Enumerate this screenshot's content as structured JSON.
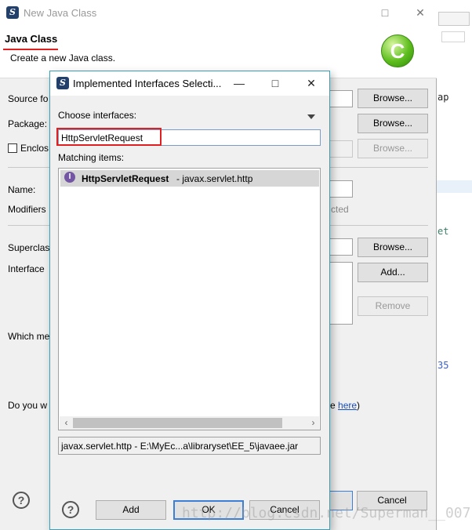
{
  "window": {
    "title": "New Java Class",
    "header_title": "Java Class",
    "header_subtitle": "Create a new Java class.",
    "logo_letter": "C"
  },
  "form": {
    "source_folder_label": "Source fo",
    "package_label": "Package:",
    "enclosing_label": "Enclos",
    "name_label": "Name:",
    "modifiers_label": "Modifiers",
    "modifiers_tail": "cted",
    "superclass_label": "Superclas",
    "interfaces_label": "Interface",
    "which_methods_label": "Which me",
    "comments_label": "Do you w",
    "comments_link_fragment": "e ",
    "comments_link": "here",
    "comments_link_close": ")",
    "browse_label": "Browse...",
    "add_label": "Add...",
    "remove_label": "Remove",
    "cancel_label": "Cancel"
  },
  "background_editor": {
    "frag_ap": "ap",
    "frag_et": "et",
    "frag_35": "35"
  },
  "dialog": {
    "title": "Implemented Interfaces Selecti...",
    "choose_label": "Choose interfaces:",
    "filter_value": "HttpServletRequest",
    "matching_label": "Matching items:",
    "matches": [
      {
        "name": "HttpServletRequest",
        "package": " - javax.servlet.http",
        "icon": "I"
      }
    ],
    "status_text": "javax.servlet.http - E:\\MyEc...a\\libraryset\\EE_5\\javaee.jar",
    "add_label": "Add",
    "ok_label": "OK",
    "cancel_label": "Cancel"
  },
  "watermark": "http://blog.csdn.net/Superman__007",
  "icons": {
    "app": "eclipse-s-icon",
    "minimize": "—",
    "maximize": "□",
    "close": "✕",
    "help": "?",
    "interface": "interface-icon",
    "scroll_left": "‹",
    "scroll_right": "›"
  },
  "colors": {
    "highlight_red": "#e02020",
    "interface_icon": "#7355a3",
    "dialog_border": "#3aa0b8"
  }
}
